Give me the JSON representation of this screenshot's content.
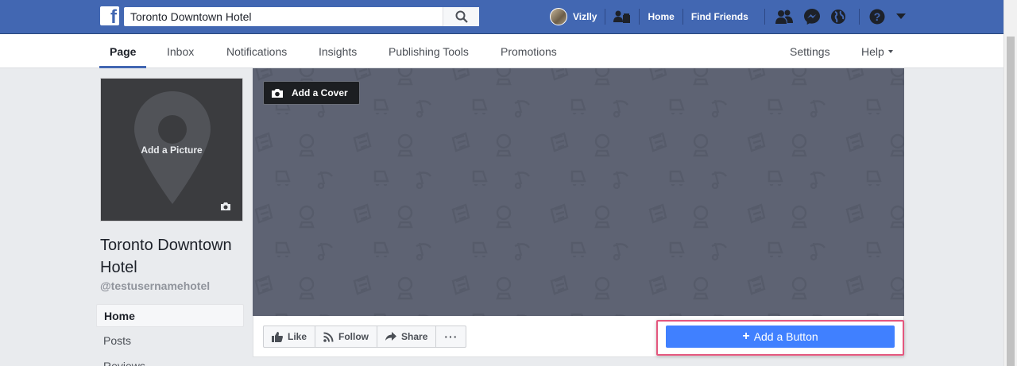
{
  "topbar": {
    "logo_letter": "f",
    "search_value": "Toronto Downtown Hotel",
    "user_name": "Vizlly",
    "home_label": "Home",
    "find_friends_label": "Find Friends"
  },
  "tabs": [
    {
      "label": "Page",
      "active": true
    },
    {
      "label": "Inbox"
    },
    {
      "label": "Notifications"
    },
    {
      "label": "Insights"
    },
    {
      "label": "Publishing Tools"
    },
    {
      "label": "Promotions"
    },
    {
      "label": "Settings"
    },
    {
      "label": "Help"
    }
  ],
  "profile": {
    "add_picture_label": "Add a Picture",
    "page_name": "Toronto Downtown Hotel",
    "username": "@testusernamehotel"
  },
  "leftnav": [
    {
      "label": "Home",
      "active": true
    },
    {
      "label": "Posts"
    },
    {
      "label": "Reviews"
    }
  ],
  "cover": {
    "add_cover_label": "Add a Cover"
  },
  "actions": {
    "like_label": "Like",
    "follow_label": "Follow",
    "share_label": "Share",
    "more_label": "···",
    "add_button_label": "Add a Button"
  },
  "colors": {
    "brand_blue": "#4267b2",
    "cta_blue": "#4080ff",
    "highlight_pink": "#e4577e",
    "cover_gray": "#5e6373"
  }
}
